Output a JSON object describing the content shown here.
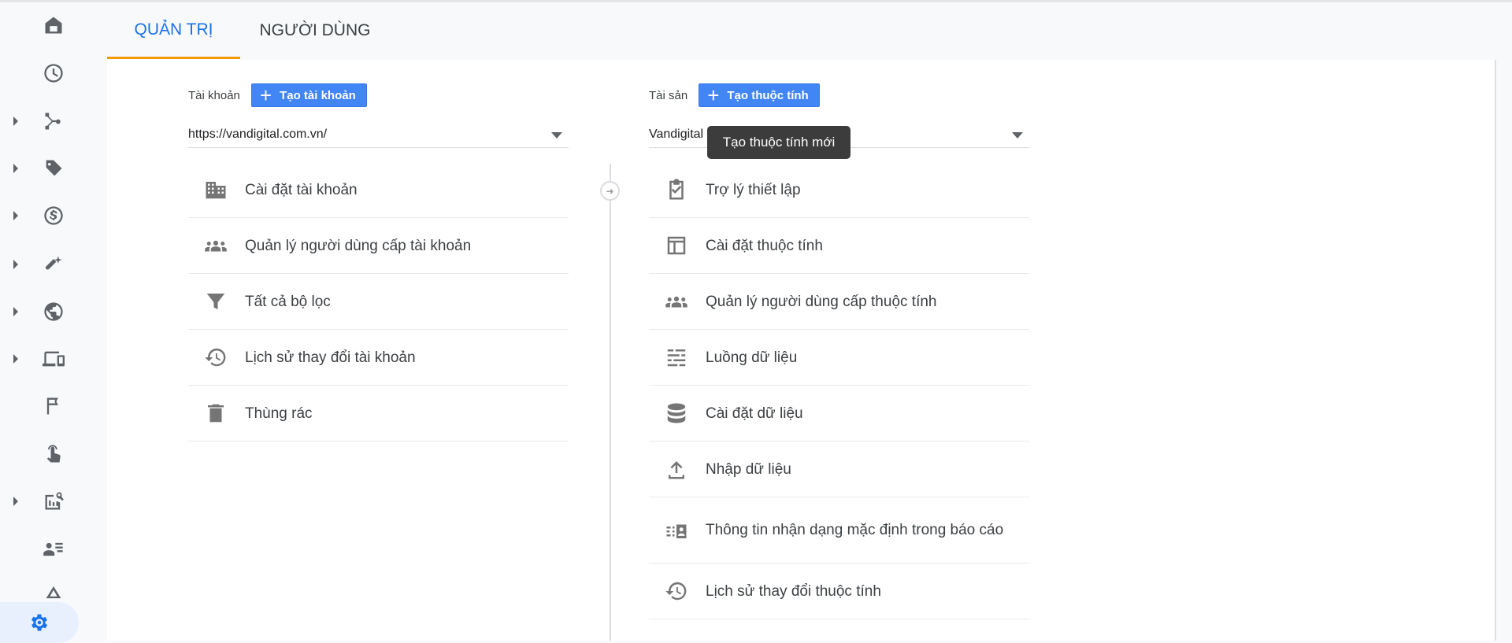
{
  "sidebar": {
    "items": [
      {
        "icon": "home-icon",
        "expandable": false
      },
      {
        "icon": "clock-icon",
        "expandable": false
      },
      {
        "icon": "acquisition-icon",
        "expandable": true
      },
      {
        "icon": "tag-icon",
        "expandable": true
      },
      {
        "icon": "dollar-icon",
        "expandable": true
      },
      {
        "icon": "magnet-icon",
        "expandable": true
      },
      {
        "icon": "globe-icon",
        "expandable": true
      },
      {
        "icon": "devices-icon",
        "expandable": true
      },
      {
        "icon": "flag-icon",
        "expandable": false
      },
      {
        "icon": "touch-icon",
        "expandable": false
      },
      {
        "icon": "report-search-icon",
        "expandable": true
      },
      {
        "icon": "user-list-icon",
        "expandable": false
      },
      {
        "icon": "triangle-icon",
        "expandable": false
      },
      {
        "icon": "gear-icon",
        "expandable": false,
        "active": true
      }
    ]
  },
  "tabs": [
    {
      "label": "QUẢN TRỊ",
      "active": true
    },
    {
      "label": "NGƯỜI DÙNG",
      "active": false
    }
  ],
  "account": {
    "label": "Tài khoản",
    "create_button": "Tạo tài khoản",
    "selected": "https://vandigital.com.vn/",
    "items": [
      {
        "icon": "building-icon",
        "label": "Cài đặt tài khoản"
      },
      {
        "icon": "people-icon",
        "label": "Quản lý người dùng cấp tài khoản"
      },
      {
        "icon": "filter-icon",
        "label": "Tất cả bộ lọc"
      },
      {
        "icon": "history-icon",
        "label": "Lịch sử thay đổi tài khoản"
      },
      {
        "icon": "trash-icon",
        "label": "Thùng rác"
      }
    ]
  },
  "property": {
    "label": "Tài sản",
    "create_button": "Tạo thuộc tính",
    "selected": "Vandigital",
    "tooltip": "Tạo thuộc tính mới",
    "items": [
      {
        "icon": "clipboard-check-icon",
        "label": "Trợ lý thiết lập"
      },
      {
        "icon": "layout-icon",
        "label": "Cài đặt thuộc tính"
      },
      {
        "icon": "people-icon",
        "label": "Quản lý người dùng cấp thuộc tính"
      },
      {
        "icon": "data-streams-icon",
        "label": "Luồng dữ liệu"
      },
      {
        "icon": "database-icon",
        "label": "Cài đặt dữ liệu"
      },
      {
        "icon": "upload-icon",
        "label": "Nhập dữ liệu"
      },
      {
        "icon": "reporting-identity-icon",
        "label": "Thông tin nhận dạng mặc định trong báo cáo"
      },
      {
        "icon": "history-icon",
        "label": "Lịch sử thay đổi thuộc tính"
      }
    ]
  },
  "colors": {
    "accent": "#1a73e8",
    "button": "#4285f4",
    "tab_underline": "#f29900"
  }
}
